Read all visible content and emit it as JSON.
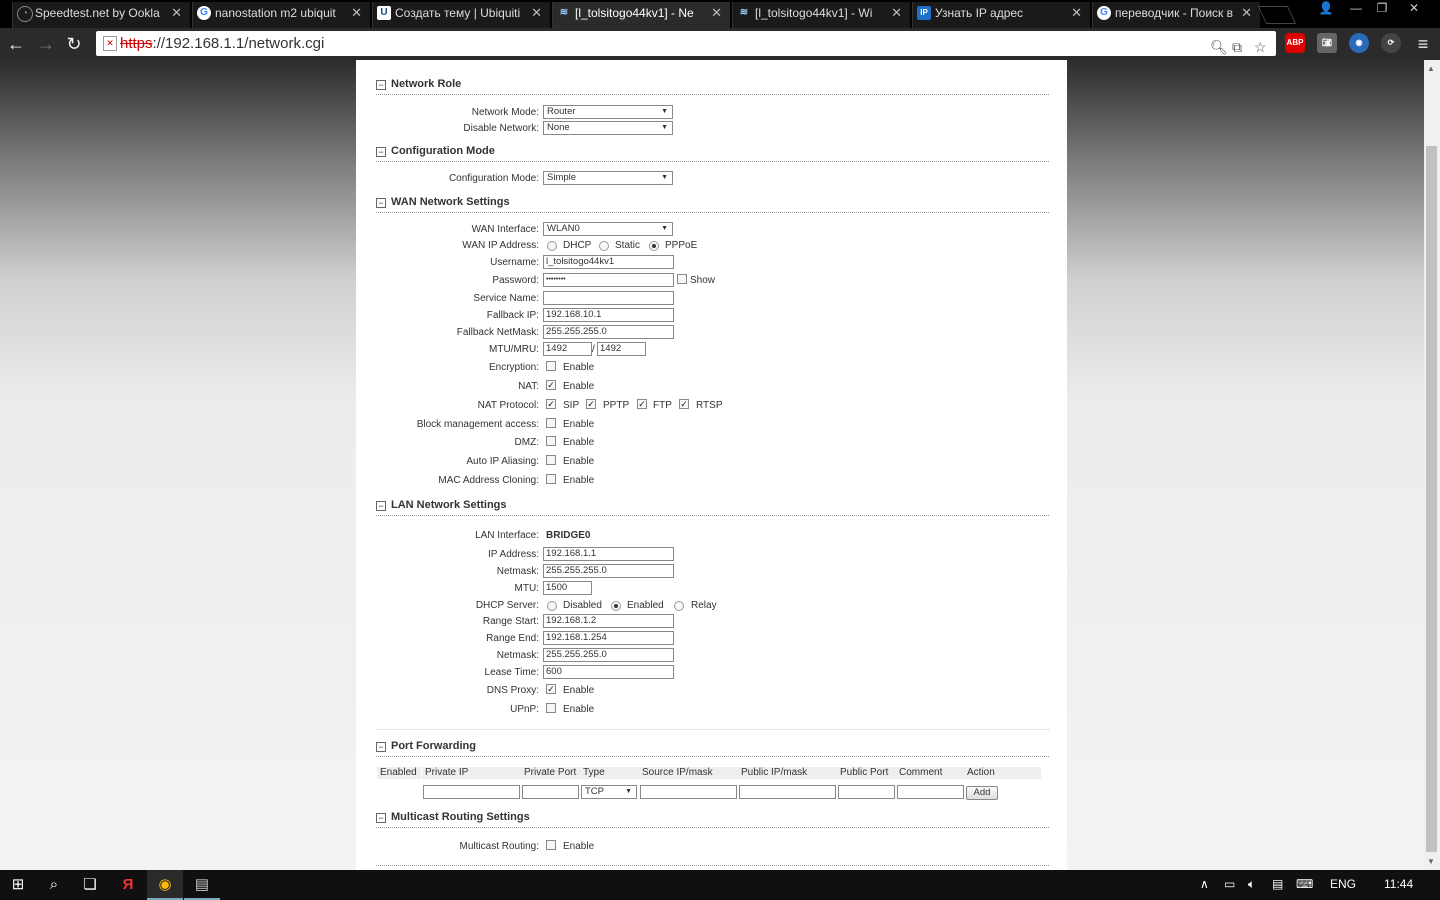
{
  "browser": {
    "tabs": [
      {
        "title": "Speedtest.net by Ookla",
        "favicon": "speedtest-icon",
        "active": false
      },
      {
        "title": "nanostation m2 ubiquit",
        "favicon": "google-icon",
        "active": false
      },
      {
        "title": "Создать тему | Ubiquiti",
        "favicon": "ubiquiti-icon",
        "active": false
      },
      {
        "title": "[l_tolsitogo44kv1] - Ne",
        "favicon": "airos-icon",
        "active": true
      },
      {
        "title": "[l_tolsitogo44kv1] - Wi",
        "favicon": "airos-icon",
        "active": false
      },
      {
        "title": "Узнать IP адрес",
        "favicon": "ip-icon",
        "active": false
      },
      {
        "title": "переводчик - Поиск в",
        "favicon": "google-icon",
        "active": false
      }
    ],
    "url_scheme": "https",
    "url_rest": "://192.168.1.1/network.cgi",
    "ext_abp": "ABP"
  },
  "page": {
    "sections": {
      "network_role": "Network Role",
      "config_mode": "Configuration Mode",
      "wan": "WAN Network Settings",
      "lan": "LAN Network Settings",
      "port_forwarding": "Port Forwarding",
      "multicast": "Multicast Routing Settings"
    },
    "network_role": {
      "mode_label": "Network Mode:",
      "mode_value": "Router",
      "disable_label": "Disable Network:",
      "disable_value": "None"
    },
    "config_mode": {
      "label": "Configuration Mode:",
      "value": "Simple"
    },
    "wan": {
      "interface_label": "WAN Interface:",
      "interface_value": "WLAN0",
      "ip_label": "WAN IP Address:",
      "ip_options": [
        "DHCP",
        "Static",
        "PPPoE"
      ],
      "ip_selected": "PPPoE",
      "username_label": "Username:",
      "username_value": "l_tolsitogo44kv1",
      "password_label": "Password:",
      "password_value": "••••••••",
      "show_label": "Show",
      "service_label": "Service Name:",
      "service_value": "",
      "fallback_ip_label": "Fallback IP:",
      "fallback_ip_value": "192.168.10.1",
      "fallback_mask_label": "Fallback NetMask:",
      "fallback_mask_value": "255.255.255.0",
      "mtu_label": "MTU/MRU:",
      "mtu_value": "1492",
      "mru_value": "1492",
      "mtu_sep": "/",
      "encryption_label": "Encryption:",
      "nat_label": "NAT:",
      "nat_protocol_label": "NAT Protocol:",
      "nat_protocols": [
        "SIP",
        "PPTP",
        "FTP",
        "RTSP"
      ],
      "block_label": "Block management access:",
      "dmz_label": "DMZ:",
      "aliasing_label": "Auto IP Aliasing:",
      "cloning_label": "MAC Address Cloning:",
      "enable_text": "Enable"
    },
    "lan": {
      "interface_label": "LAN Interface:",
      "interface_value": "BRIDGE0",
      "ip_label": "IP Address:",
      "ip_value": "192.168.1.1",
      "netmask_label": "Netmask:",
      "netmask_value": "255.255.255.0",
      "mtu_label": "MTU:",
      "mtu_value": "1500",
      "dhcp_label": "DHCP Server:",
      "dhcp_options": [
        "Disabled",
        "Enabled",
        "Relay"
      ],
      "dhcp_selected": "Enabled",
      "range_start_label": "Range Start:",
      "range_start_value": "192.168.1.2",
      "range_end_label": "Range End:",
      "range_end_value": "192.168.1.254",
      "dhcp_netmask_label": "Netmask:",
      "dhcp_netmask_value": "255.255.255.0",
      "lease_label": "Lease Time:",
      "lease_value": "600",
      "dns_proxy_label": "DNS Proxy:",
      "upnp_label": "UPnP:",
      "enable_text": "Enable"
    },
    "port_forwarding": {
      "columns": [
        "Enabled",
        "Private IP",
        "Private Port",
        "Type",
        "Source IP/mask",
        "Public IP/mask",
        "Public Port",
        "Comment",
        "Action"
      ],
      "type_value": "TCP",
      "add_label": "Add"
    },
    "multicast": {
      "label": "Multicast Routing:",
      "enable_text": "Enable"
    }
  },
  "taskbar": {
    "lang": "ENG",
    "time": "11:44"
  }
}
